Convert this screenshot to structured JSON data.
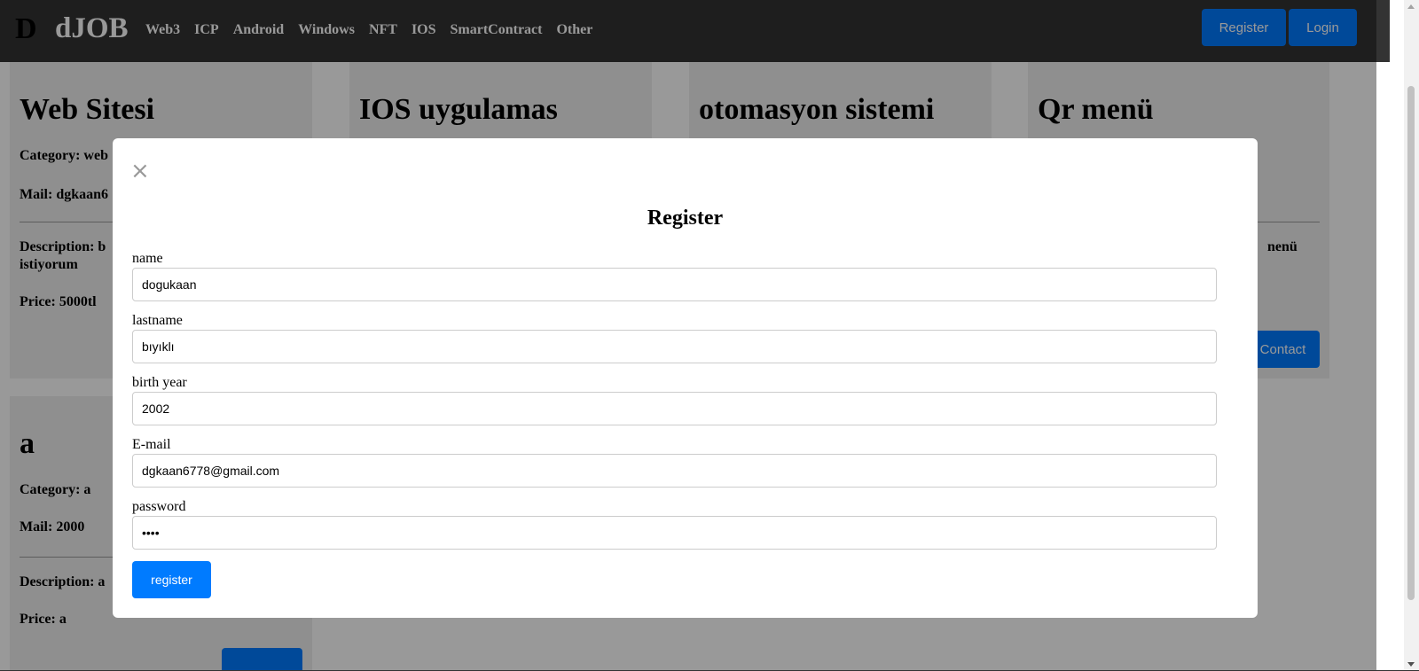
{
  "navbar": {
    "logo_mark": "D",
    "brand": "dJOB",
    "links": [
      "Web3",
      "ICP",
      "Android",
      "Windows",
      "NFT",
      "IOS",
      "SmartContract",
      "Other"
    ],
    "register_label": "Register",
    "login_label": "Login"
  },
  "cards": [
    {
      "title": "Web Sitesi",
      "category": "Category: web",
      "mail": "Mail: dgkaan6",
      "description_line1": "Description: b",
      "description_line2": "istiyorum",
      "price": "Price: 5000tl"
    },
    {
      "title": "IOS uygulamas"
    },
    {
      "title": "otomasyon sistemi"
    },
    {
      "title": "Qr menü",
      "description_fragment": "nenü",
      "contact_label": "Contact"
    },
    {
      "title": "a",
      "category": "Category: a",
      "mail": "Mail: 2000",
      "description": "Description: a",
      "price": "Price: a"
    }
  ],
  "modal": {
    "close_symbol": "×",
    "title": "Register",
    "fields": [
      {
        "label": "name",
        "value": "dogukaan"
      },
      {
        "label": "lastname",
        "value": "bıyıklı"
      },
      {
        "label": "birth year",
        "value": "2002"
      },
      {
        "label": "E-mail",
        "value": "dgkaan6778@gmail.com"
      },
      {
        "label": "password",
        "value": "••••"
      }
    ],
    "submit_label": "register"
  },
  "colors": {
    "navbar_bg": "#333333",
    "primary": "#007bff",
    "card_bg": "#efefef",
    "overlay": "rgba(0,0,0,0.4)"
  }
}
